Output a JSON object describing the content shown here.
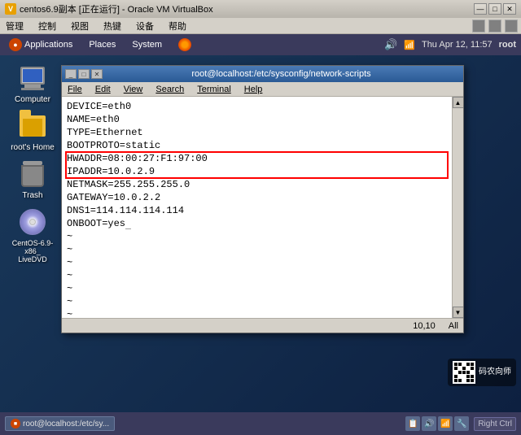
{
  "vbox": {
    "titlebar": "centos6.9副本 [正在运行] - Oracle VM VirtualBox",
    "menus": [
      "管理",
      "控制",
      "视图",
      "热键",
      "设备",
      "帮助"
    ],
    "min_btn": "—",
    "max_btn": "□",
    "close_btn": "✕"
  },
  "centos_panel": {
    "apps_label": "Applications",
    "places_label": "Places",
    "system_label": "System",
    "clock": "Thu Apr 12, 11:57",
    "user": "root"
  },
  "desktop_icons": [
    {
      "name": "Computer",
      "label": "Computer"
    },
    {
      "name": "root's Home",
      "label": "root's Home"
    },
    {
      "name": "Trash",
      "label": "Trash"
    },
    {
      "name": "CentOS-6.9-x86_LiveDVD",
      "label": "CentOS-6.9-x86_\nLiveDVD"
    }
  ],
  "terminal": {
    "title": "root@localhost:/etc/sysconfig/network-scripts",
    "menus": [
      "File",
      "Edit",
      "View",
      "Search",
      "Terminal",
      "Help"
    ],
    "search_label": "Search",
    "lines": [
      "DEVICE=eth0",
      "NAME=eth0",
      "TYPE=Ethernet",
      "BOOTPROTO=static",
      "HWADDR=08:00:27:F1:97:00",
      "IPADDR=10.0.2.9",
      "NETMASK=255.255.255.0",
      "GATEWAY=10.0.2.2",
      "DNS1=114.114.114.114",
      "ONBOOT=yes"
    ],
    "cursor_line": "ONBOOT=yes",
    "statusbar_pos": "10,10",
    "statusbar_mode": "All"
  },
  "taskbar": {
    "item_label": "root@localhost:/etc/sy...",
    "right_ctrl": "Right Ctrl"
  },
  "watermark": {
    "text": "码农向师"
  }
}
